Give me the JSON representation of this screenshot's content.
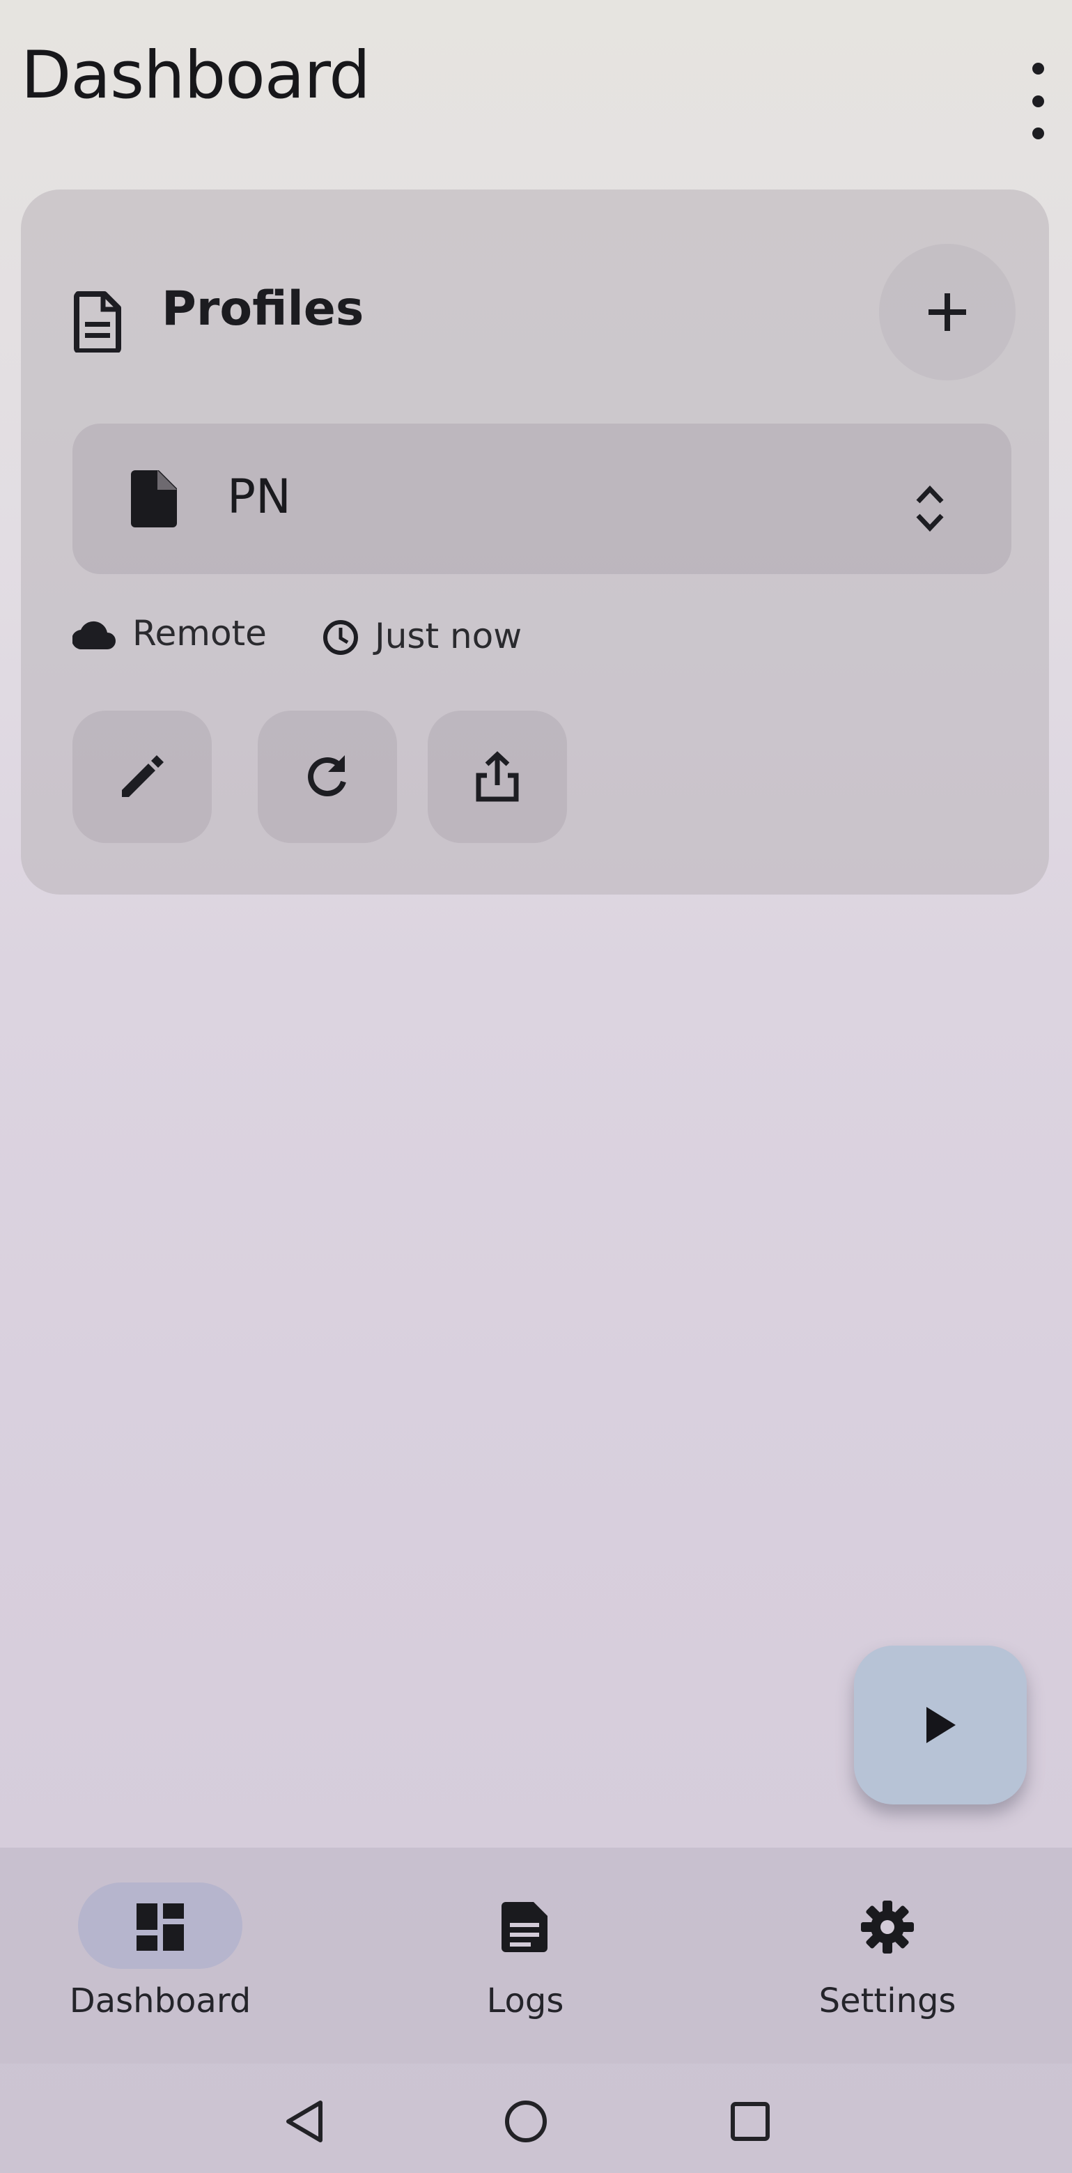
{
  "app_bar": {
    "title": "Dashboard",
    "more_icon": "more-vert-icon"
  },
  "profiles_card": {
    "title": "Profiles",
    "header_icon": "description-icon",
    "add_icon": "plus-icon",
    "selected_profile": {
      "name": "PN",
      "icon": "file-icon",
      "selector_icon": "unfold-more-icon"
    },
    "source_label": "Remote",
    "updated_label": "Just now",
    "actions": [
      {
        "icon": "edit-icon"
      },
      {
        "icon": "refresh-icon"
      },
      {
        "icon": "share-icon"
      }
    ]
  },
  "fab": {
    "icon": "play-icon"
  },
  "bottom_nav": {
    "items": [
      {
        "label": "Dashboard",
        "icon": "dashboard-icon",
        "active": true
      },
      {
        "label": "Logs",
        "icon": "logs-icon",
        "active": false
      },
      {
        "label": "Settings",
        "icon": "gear-icon",
        "active": false
      }
    ]
  },
  "system_nav": {
    "buttons": [
      "back-icon",
      "home-icon",
      "recents-icon"
    ]
  },
  "colors": {
    "text": "#17171a",
    "fab": "#b7c3d6",
    "active_nav_pill": "#b0b2cc"
  }
}
